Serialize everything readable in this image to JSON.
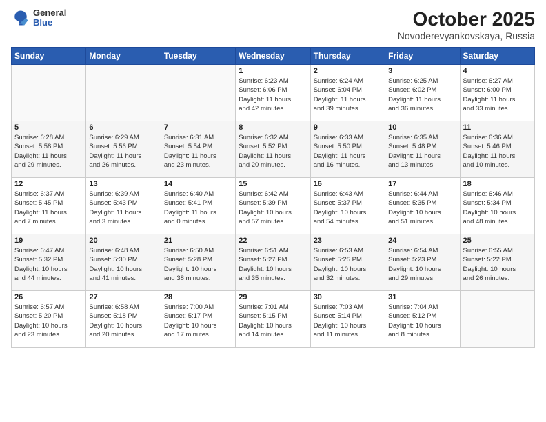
{
  "header": {
    "logo_general": "General",
    "logo_blue": "Blue",
    "month_title": "October 2025",
    "location": "Novoderevyankovskaya, Russia"
  },
  "days_of_week": [
    "Sunday",
    "Monday",
    "Tuesday",
    "Wednesday",
    "Thursday",
    "Friday",
    "Saturday"
  ],
  "weeks": [
    [
      {
        "day": "",
        "info": ""
      },
      {
        "day": "",
        "info": ""
      },
      {
        "day": "",
        "info": ""
      },
      {
        "day": "1",
        "info": "Sunrise: 6:23 AM\nSunset: 6:06 PM\nDaylight: 11 hours\nand 42 minutes."
      },
      {
        "day": "2",
        "info": "Sunrise: 6:24 AM\nSunset: 6:04 PM\nDaylight: 11 hours\nand 39 minutes."
      },
      {
        "day": "3",
        "info": "Sunrise: 6:25 AM\nSunset: 6:02 PM\nDaylight: 11 hours\nand 36 minutes."
      },
      {
        "day": "4",
        "info": "Sunrise: 6:27 AM\nSunset: 6:00 PM\nDaylight: 11 hours\nand 33 minutes."
      }
    ],
    [
      {
        "day": "5",
        "info": "Sunrise: 6:28 AM\nSunset: 5:58 PM\nDaylight: 11 hours\nand 29 minutes."
      },
      {
        "day": "6",
        "info": "Sunrise: 6:29 AM\nSunset: 5:56 PM\nDaylight: 11 hours\nand 26 minutes."
      },
      {
        "day": "7",
        "info": "Sunrise: 6:31 AM\nSunset: 5:54 PM\nDaylight: 11 hours\nand 23 minutes."
      },
      {
        "day": "8",
        "info": "Sunrise: 6:32 AM\nSunset: 5:52 PM\nDaylight: 11 hours\nand 20 minutes."
      },
      {
        "day": "9",
        "info": "Sunrise: 6:33 AM\nSunset: 5:50 PM\nDaylight: 11 hours\nand 16 minutes."
      },
      {
        "day": "10",
        "info": "Sunrise: 6:35 AM\nSunset: 5:48 PM\nDaylight: 11 hours\nand 13 minutes."
      },
      {
        "day": "11",
        "info": "Sunrise: 6:36 AM\nSunset: 5:46 PM\nDaylight: 11 hours\nand 10 minutes."
      }
    ],
    [
      {
        "day": "12",
        "info": "Sunrise: 6:37 AM\nSunset: 5:45 PM\nDaylight: 11 hours\nand 7 minutes."
      },
      {
        "day": "13",
        "info": "Sunrise: 6:39 AM\nSunset: 5:43 PM\nDaylight: 11 hours\nand 3 minutes."
      },
      {
        "day": "14",
        "info": "Sunrise: 6:40 AM\nSunset: 5:41 PM\nDaylight: 11 hours\nand 0 minutes."
      },
      {
        "day": "15",
        "info": "Sunrise: 6:42 AM\nSunset: 5:39 PM\nDaylight: 10 hours\nand 57 minutes."
      },
      {
        "day": "16",
        "info": "Sunrise: 6:43 AM\nSunset: 5:37 PM\nDaylight: 10 hours\nand 54 minutes."
      },
      {
        "day": "17",
        "info": "Sunrise: 6:44 AM\nSunset: 5:35 PM\nDaylight: 10 hours\nand 51 minutes."
      },
      {
        "day": "18",
        "info": "Sunrise: 6:46 AM\nSunset: 5:34 PM\nDaylight: 10 hours\nand 48 minutes."
      }
    ],
    [
      {
        "day": "19",
        "info": "Sunrise: 6:47 AM\nSunset: 5:32 PM\nDaylight: 10 hours\nand 44 minutes."
      },
      {
        "day": "20",
        "info": "Sunrise: 6:48 AM\nSunset: 5:30 PM\nDaylight: 10 hours\nand 41 minutes."
      },
      {
        "day": "21",
        "info": "Sunrise: 6:50 AM\nSunset: 5:28 PM\nDaylight: 10 hours\nand 38 minutes."
      },
      {
        "day": "22",
        "info": "Sunrise: 6:51 AM\nSunset: 5:27 PM\nDaylight: 10 hours\nand 35 minutes."
      },
      {
        "day": "23",
        "info": "Sunrise: 6:53 AM\nSunset: 5:25 PM\nDaylight: 10 hours\nand 32 minutes."
      },
      {
        "day": "24",
        "info": "Sunrise: 6:54 AM\nSunset: 5:23 PM\nDaylight: 10 hours\nand 29 minutes."
      },
      {
        "day": "25",
        "info": "Sunrise: 6:55 AM\nSunset: 5:22 PM\nDaylight: 10 hours\nand 26 minutes."
      }
    ],
    [
      {
        "day": "26",
        "info": "Sunrise: 6:57 AM\nSunset: 5:20 PM\nDaylight: 10 hours\nand 23 minutes."
      },
      {
        "day": "27",
        "info": "Sunrise: 6:58 AM\nSunset: 5:18 PM\nDaylight: 10 hours\nand 20 minutes."
      },
      {
        "day": "28",
        "info": "Sunrise: 7:00 AM\nSunset: 5:17 PM\nDaylight: 10 hours\nand 17 minutes."
      },
      {
        "day": "29",
        "info": "Sunrise: 7:01 AM\nSunset: 5:15 PM\nDaylight: 10 hours\nand 14 minutes."
      },
      {
        "day": "30",
        "info": "Sunrise: 7:03 AM\nSunset: 5:14 PM\nDaylight: 10 hours\nand 11 minutes."
      },
      {
        "day": "31",
        "info": "Sunrise: 7:04 AM\nSunset: 5:12 PM\nDaylight: 10 hours\nand 8 minutes."
      },
      {
        "day": "",
        "info": ""
      }
    ]
  ]
}
